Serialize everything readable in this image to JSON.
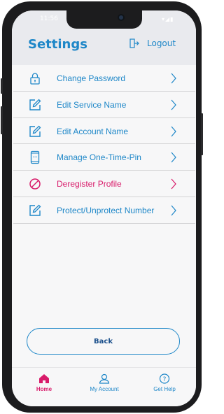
{
  "status_bar": {
    "time": "11:56",
    "icons": "▾◢▮"
  },
  "header": {
    "title": "Settings",
    "logout_label": "Logout"
  },
  "menu": {
    "items": [
      {
        "label": "Change Password",
        "icon": "lock-icon"
      },
      {
        "label": "Edit Service Name",
        "icon": "edit-icon"
      },
      {
        "label": "Edit Account Name",
        "icon": "edit-icon"
      },
      {
        "label": "Manage One-Time-Pin",
        "icon": "phone-icon"
      },
      {
        "label": "Deregister Profile",
        "icon": "prohibited-icon",
        "color": "#d81b6a"
      },
      {
        "label": "Protect/Unprotect Number",
        "icon": "edit-icon"
      }
    ]
  },
  "back_label": "Back",
  "tabs": [
    {
      "label": "Home",
      "icon": "home-icon",
      "active": true
    },
    {
      "label": "My Account",
      "icon": "user-icon",
      "active": false
    },
    {
      "label": "Get Help",
      "icon": "help-icon",
      "active": false
    }
  ],
  "colors": {
    "accent": "#1e87c8",
    "danger": "#d81b6a",
    "button_text": "#1a4f8b"
  }
}
